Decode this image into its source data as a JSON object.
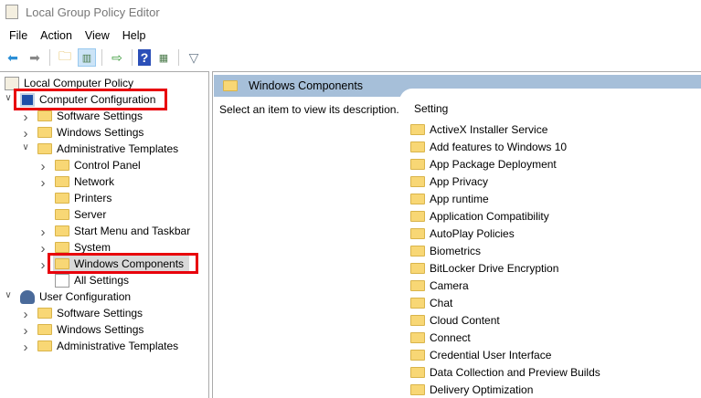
{
  "window": {
    "title": "Local Group Policy Editor"
  },
  "menu": [
    "File",
    "Action",
    "View",
    "Help"
  ],
  "toolbar": {
    "icons": [
      "back-arrow-icon",
      "forward-arrow-icon",
      "up-folder-icon",
      "show-hide-tree-icon",
      "export-list-icon",
      "help-icon",
      "show-action-pane-icon",
      "filter-icon"
    ]
  },
  "tree": [
    {
      "label": "Local Computer Policy",
      "level": 0,
      "chevron": ""
    },
    {
      "label": "Computer Configuration",
      "level": 1,
      "chevron": "open",
      "highlight": true
    },
    {
      "label": "Software Settings",
      "level": 2,
      "chevron": "closed"
    },
    {
      "label": "Windows Settings",
      "level": 2,
      "chevron": "closed"
    },
    {
      "label": "Administrative Templates",
      "level": 2,
      "chevron": "open"
    },
    {
      "label": "Control Panel",
      "level": 3,
      "chevron": "closed"
    },
    {
      "label": "Network",
      "level": 3,
      "chevron": "closed"
    },
    {
      "label": "Printers",
      "level": 3,
      "chevron": ""
    },
    {
      "label": "Server",
      "level": 3,
      "chevron": ""
    },
    {
      "label": "Start Menu and Taskbar",
      "level": 3,
      "chevron": "closed"
    },
    {
      "label": "System",
      "level": 3,
      "chevron": "closed"
    },
    {
      "label": "Windows Components",
      "level": 3,
      "chevron": "closed",
      "selected": true,
      "highlight": true
    },
    {
      "label": "All Settings",
      "level": 3,
      "chevron": ""
    },
    {
      "label": "User Configuration",
      "level": 1,
      "chevron": "open"
    },
    {
      "label": "Software Settings",
      "level": 2,
      "chevron": "closed"
    },
    {
      "label": "Windows Settings",
      "level": 2,
      "chevron": "closed"
    },
    {
      "label": "Administrative Templates",
      "level": 2,
      "chevron": "closed"
    }
  ],
  "right": {
    "header": "Windows Components",
    "description": "Select an item to view its description.",
    "column": "Setting",
    "items": [
      "ActiveX Installer Service",
      "Add features to Windows 10",
      "App Package Deployment",
      "App Privacy",
      "App runtime",
      "Application Compatibility",
      "AutoPlay Policies",
      "Biometrics",
      "BitLocker Drive Encryption",
      "Camera",
      "Chat",
      "Cloud Content",
      "Connect",
      "Credential User Interface",
      "Data Collection and Preview Builds",
      "Delivery Optimization"
    ]
  },
  "colors": {
    "highlight": "#e8000b",
    "header": "#a6bfd9",
    "folder": "#f8d775"
  }
}
